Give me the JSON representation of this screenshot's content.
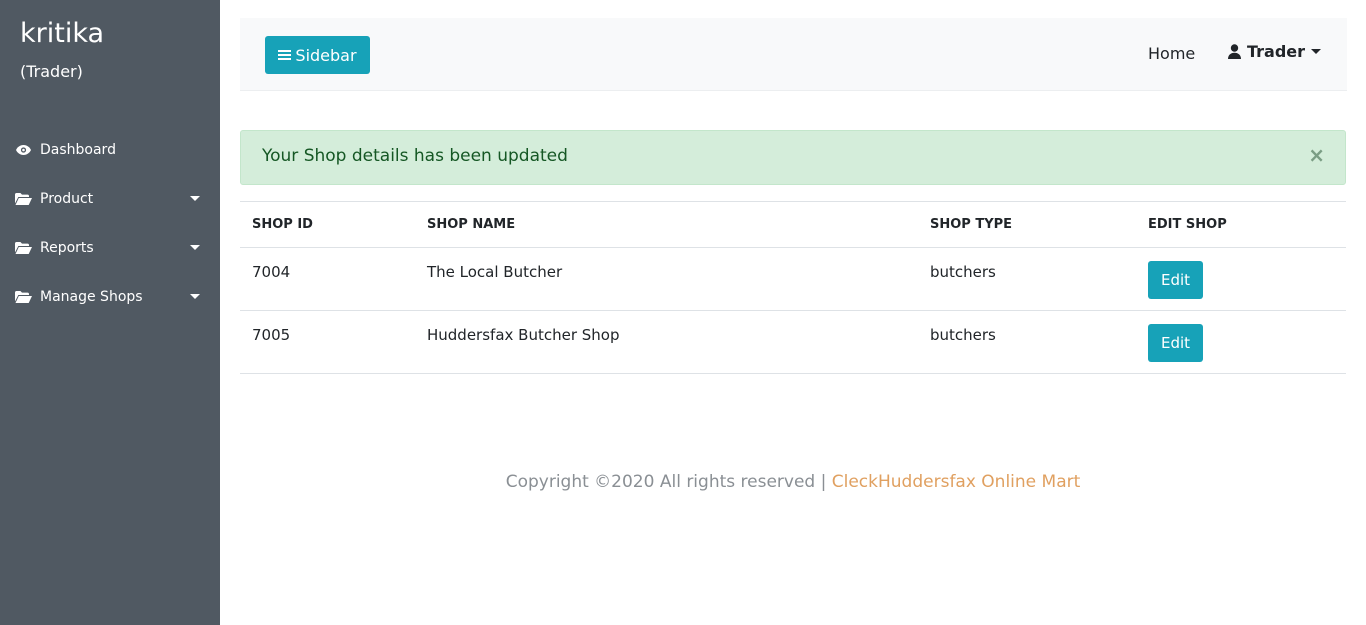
{
  "sidebar": {
    "user_name": "kritika",
    "user_role": "(Trader)",
    "items": [
      {
        "label": "Dashboard",
        "icon": "eye-icon",
        "has_caret": false
      },
      {
        "label": "Product",
        "icon": "folder-open-icon",
        "has_caret": true
      },
      {
        "label": "Reports",
        "icon": "folder-open-icon",
        "has_caret": true
      },
      {
        "label": "Manage Shops",
        "icon": "folder-open-icon",
        "has_caret": true
      }
    ]
  },
  "topbar": {
    "sidebar_button_label": "Sidebar",
    "home_label": "Home",
    "user_menu_label": "Trader"
  },
  "alert": {
    "message": "Your Shop details has been updated",
    "close_symbol": "×"
  },
  "table": {
    "headers": [
      "SHOP ID",
      "SHOP NAME",
      "SHOP TYPE",
      "EDIT SHOP"
    ],
    "rows": [
      {
        "id": "7004",
        "name": "The Local Butcher",
        "type": "butchers",
        "action": "Edit"
      },
      {
        "id": "7005",
        "name": "Huddersfax Butcher Shop",
        "type": "butchers",
        "action": "Edit"
      }
    ]
  },
  "footer": {
    "copyright": "Copyright ©2020 All rights reserved | ",
    "brand": "CleckHuddersfax Online Mart"
  },
  "colors": {
    "sidebar_bg": "#505962",
    "accent": "#17a2b8",
    "alert_bg": "#d4edda",
    "footer_brand": "#e0a060"
  }
}
